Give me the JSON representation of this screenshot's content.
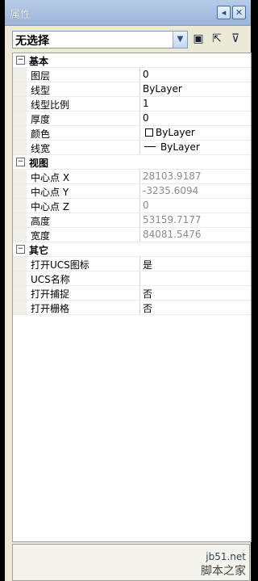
{
  "window": {
    "title": "属性"
  },
  "titlebar_buttons": [
    "pin-icon",
    "close-icon"
  ],
  "selector": {
    "value": "无选择"
  },
  "toolbar": [
    "quick-select-icon",
    "select-objects-icon",
    "pickadd-icon"
  ],
  "categories": [
    {
      "label": "基本",
      "toggle": "日",
      "props": [
        {
          "name": "图层",
          "value": "0",
          "readonly": false
        },
        {
          "name": "线型",
          "value": "ByLayer",
          "readonly": false
        },
        {
          "name": "线型比例",
          "value": "1",
          "readonly": false
        },
        {
          "name": "厚度",
          "value": "0",
          "readonly": false
        },
        {
          "name": "颜色",
          "value": "ByLayer",
          "readonly": false,
          "kind": "color"
        },
        {
          "name": "线宽",
          "value": "ByLayer",
          "readonly": false,
          "kind": "lineweight"
        }
      ]
    },
    {
      "label": "视图",
      "toggle": "日",
      "props": [
        {
          "name": "中心点 X",
          "value": "28103.9187",
          "readonly": true
        },
        {
          "name": "中心点 Y",
          "value": "-3235.6094",
          "readonly": true
        },
        {
          "name": "中心点 Z",
          "value": "0",
          "readonly": true
        },
        {
          "name": "高度",
          "value": "53159.7177",
          "readonly": true
        },
        {
          "name": "宽度",
          "value": "84081.5476",
          "readonly": true
        }
      ]
    },
    {
      "label": "其它",
      "toggle": "日",
      "props": [
        {
          "name": "打开UCS图标",
          "value": "是",
          "readonly": false
        },
        {
          "name": "UCS名称",
          "value": "",
          "readonly": false
        },
        {
          "name": "打开捕捉",
          "value": "否",
          "readonly": false
        },
        {
          "name": "打开栅格",
          "value": "否",
          "readonly": false
        }
      ]
    }
  ],
  "watermark": {
    "domain": "jb51.net",
    "name": "脚本之家"
  }
}
